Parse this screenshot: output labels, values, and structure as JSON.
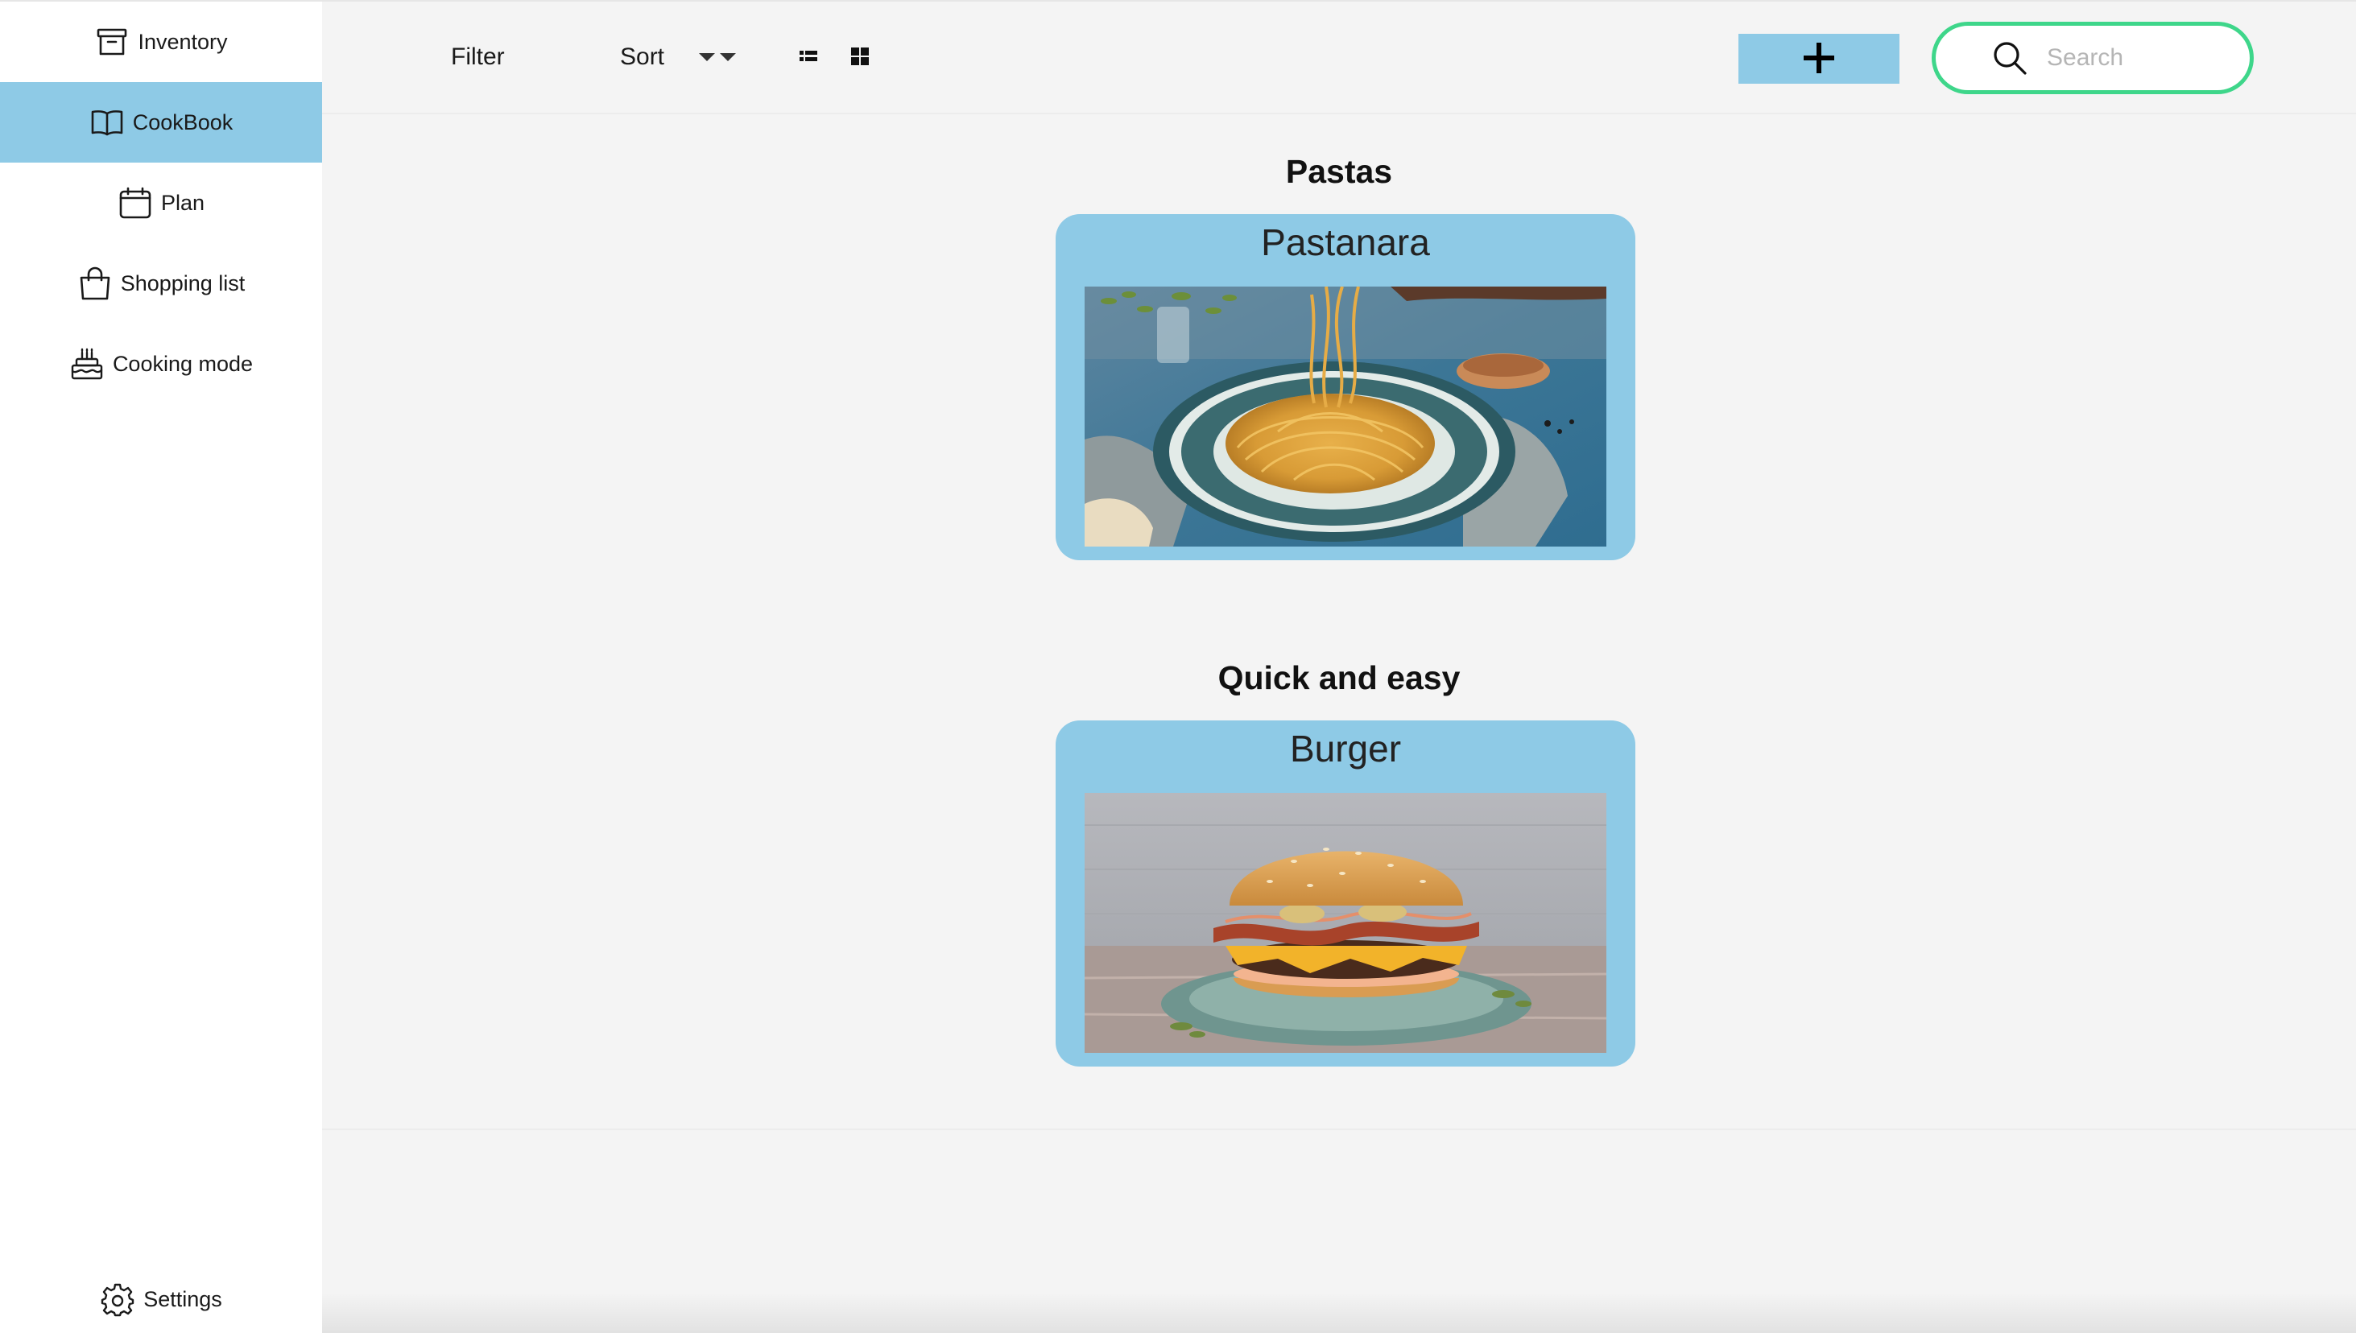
{
  "sidebar": {
    "items": [
      {
        "label": "Inventory",
        "icon": "archive-box-icon",
        "active": false
      },
      {
        "label": "CookBook",
        "icon": "open-book-icon",
        "active": true
      },
      {
        "label": "Plan",
        "icon": "calendar-icon",
        "active": false
      },
      {
        "label": "Shopping list",
        "icon": "shopping-bag-icon",
        "active": false
      },
      {
        "label": "Cooking mode",
        "icon": "cake-icon",
        "active": false
      }
    ],
    "settings": {
      "label": "Settings",
      "icon": "gear-icon"
    }
  },
  "toolbar": {
    "filter_label": "Filter",
    "sort_label": "Sort",
    "view_modes": [
      "list-view-icon",
      "grid-view-icon"
    ],
    "add_icon": "plus-icon",
    "search": {
      "placeholder": "Search",
      "value": ""
    }
  },
  "sections": [
    {
      "title": "Pastas",
      "recipes": [
        {
          "name": "Pastanara",
          "image": "spaghetti-plate"
        }
      ]
    },
    {
      "title": "Quick and easy",
      "recipes": [
        {
          "name": "Burger",
          "image": "bacon-cheeseburger"
        }
      ]
    }
  ],
  "colors": {
    "accent": "#8ecae6",
    "search_border": "#3ed68a",
    "sidebar_bg": "#ffffff",
    "content_bg": "#f4f4f4"
  }
}
